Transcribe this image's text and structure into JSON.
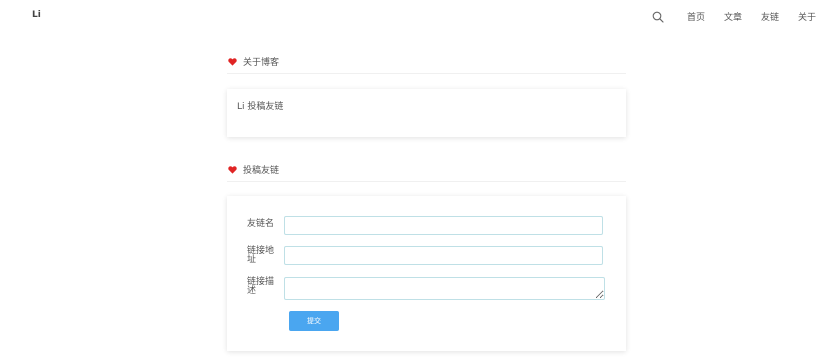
{
  "header": {
    "brand": "Li",
    "search_icon": "search-icon",
    "nav": [
      "首页",
      "文章",
      "友链",
      "关于"
    ]
  },
  "about": {
    "title": "关于博客",
    "content": "Li 投稿友链"
  },
  "submit_section": {
    "title": "投稿友链",
    "fields": [
      {
        "label": "友链名",
        "value": ""
      },
      {
        "label": "链接地址",
        "value": ""
      },
      {
        "label": "链接描述",
        "value": ""
      }
    ],
    "submit_label": "提交"
  },
  "colors": {
    "accent": "#4aa6f0",
    "heart": "#e02424",
    "input_border": "#bfe0e6"
  }
}
